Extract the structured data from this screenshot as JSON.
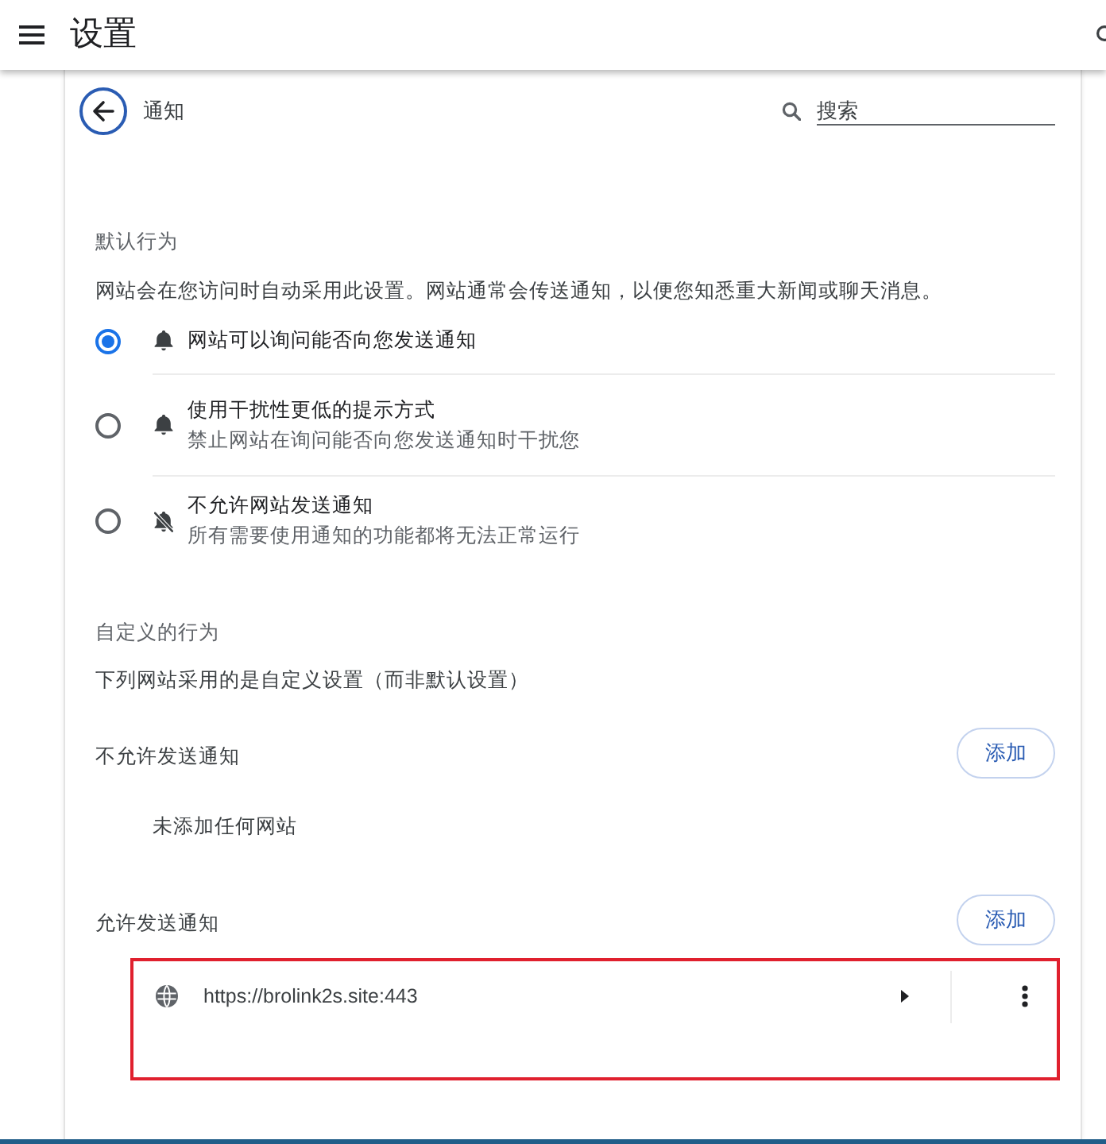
{
  "app_bar": {
    "title": "设置"
  },
  "page_header": {
    "title": "通知",
    "search": {
      "placeholder": "搜索"
    }
  },
  "default_behavior": {
    "heading": "默认行为",
    "description": "网站会在您访问时自动采用此设置。网站通常会传送通知，以便您知悉重大新闻或聊天消息。",
    "options": [
      {
        "kind": "ask",
        "label": "网站可以询问能否向您发送通知",
        "selected": true
      },
      {
        "kind": "quiet",
        "label": "使用干扰性更低的提示方式",
        "description": "禁止网站在询问能否向您发送通知时干扰您",
        "selected": false
      },
      {
        "kind": "block",
        "label": "不允许网站发送通知",
        "description": "所有需要使用通知的功能都将无法正常运行",
        "selected": false
      }
    ]
  },
  "custom_behavior": {
    "heading": "自定义的行为",
    "description": "下列网站采用的是自定义设置（而非默认设置）",
    "lists": [
      {
        "title": "不允许发送通知",
        "add_button": "添加",
        "empty_text": "未添加任何网站"
      },
      {
        "title": "允许发送通知",
        "add_button": "添加",
        "sites": [
          {
            "url": "https://brolink2s.site:443",
            "highlighted": true
          }
        ]
      }
    ]
  }
}
